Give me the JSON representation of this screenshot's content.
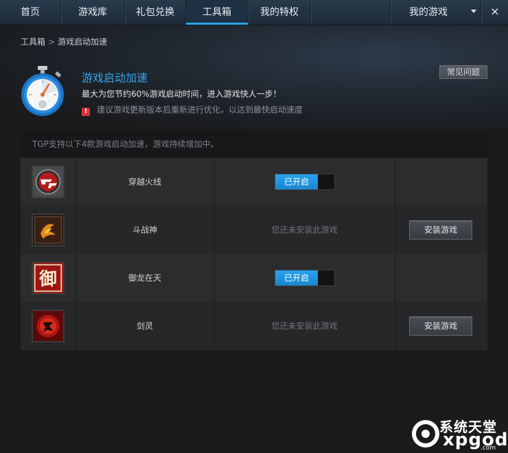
{
  "nav": {
    "tabs": [
      {
        "label": "首页"
      },
      {
        "label": "游戏库"
      },
      {
        "label": "礼包兑换"
      },
      {
        "label": "工具箱"
      },
      {
        "label": "我的特权"
      }
    ],
    "active_tab": "工具箱",
    "my_games_label": "我的游戏",
    "close_label": "×"
  },
  "breadcrumb": {
    "root": "工具箱",
    "separator": ">",
    "current": "游戏启动加速"
  },
  "feature": {
    "title": "游戏启动加速",
    "description": "最大为您节约60%游戏启动时间，进入游戏快人一步！",
    "warning": "建议游戏更新版本后重新进行优化，以达到最快启动速度",
    "warning_icon": "!",
    "faq_label": "常见问题"
  },
  "games_panel": {
    "note": "TGP支持以下4款游戏启动加速，游戏持续增加中。",
    "games": [
      {
        "name": "穿越火线",
        "status": "已开启",
        "icon": "crossfire-icon"
      },
      {
        "name": "斗战神",
        "status": "您还未安装此游戏",
        "action": "安装游戏",
        "icon": "douzhanshen-icon"
      },
      {
        "name": "御龙在天",
        "status": "已开启",
        "icon": "yulongzaitian-icon",
        "icon_char": "御"
      },
      {
        "name": "剑灵",
        "status": "您还未安装此游戏",
        "action": "安装游戏",
        "icon": "jianling-icon"
      }
    ]
  },
  "watermark": {
    "line1": "系统天堂",
    "line2": "xpgod",
    "line3": ".com"
  },
  "colors": {
    "accent": "#2ea3e8",
    "title_blue": "#32a7ec",
    "warn_red": "#d9303a"
  }
}
